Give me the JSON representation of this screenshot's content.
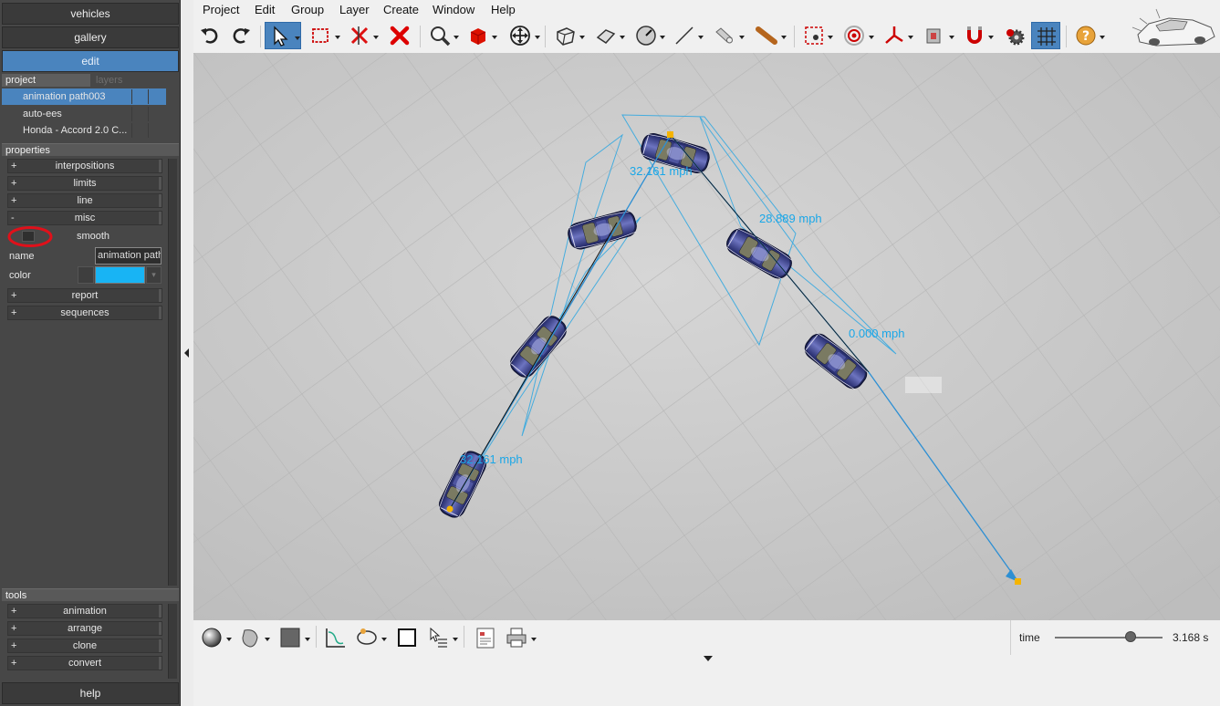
{
  "left_panel": {
    "nav": {
      "vehicles": "vehicles",
      "gallery": "gallery",
      "edit": "edit"
    },
    "project_tabs": {
      "project": "project",
      "layers": "layers"
    },
    "project_items": [
      "animation path003",
      "auto-ees",
      "Honda - Accord 2.0 C..."
    ],
    "properties_header": "properties",
    "properties": {
      "interpositions": "interpositions",
      "limits": "limits",
      "line": "line",
      "misc": "misc",
      "smooth": "smooth",
      "name_label": "name",
      "name_value": "animation path",
      "color_label": "color",
      "color_value": "#18b4f4",
      "report": "report",
      "sequences": "sequences"
    },
    "expand_symbol": "+",
    "collapse_symbol": "-",
    "tools_header": "tools",
    "tools": [
      "animation",
      "arrange",
      "clone",
      "convert"
    ],
    "help": "help"
  },
  "menubar": [
    "Project",
    "Edit",
    "Group",
    "Layer",
    "Create",
    "Window",
    "Help"
  ],
  "toolbar_icons": [
    "undo-icon",
    "redo-icon",
    "select-arrow-icon",
    "rectangle-select-icon",
    "delete-point-icon",
    "delete-x-icon",
    "zoom-icon",
    "red-cube-icon",
    "move-icon",
    "box-icon",
    "plane-icon",
    "gauge-icon",
    "line-icon",
    "cylinder-icon",
    "stick-icon",
    "target-square-icon",
    "target-circle-icon",
    "axes-icon",
    "camera-icon",
    "magnet-icon",
    "gears-icon",
    "grid-icon",
    "help-icon"
  ],
  "viewport": {
    "speed_labels": [
      "32.161 mph",
      "28.889 mph",
      "0.000 mph",
      "32.161 mph"
    ]
  },
  "bottom_toolbar_icons": [
    "sphere-icon",
    "shape-icon",
    "color-swatch-icon",
    "graph-icon",
    "lasso-icon",
    "square-icon",
    "cursor-list-icon",
    "report-icon",
    "print-icon"
  ],
  "time": {
    "label": "time",
    "value": "3.168 s",
    "position": 0.7
  },
  "colors": {
    "accent": "#4a84be",
    "path": "#1aa7e8",
    "panel": "#474747"
  }
}
